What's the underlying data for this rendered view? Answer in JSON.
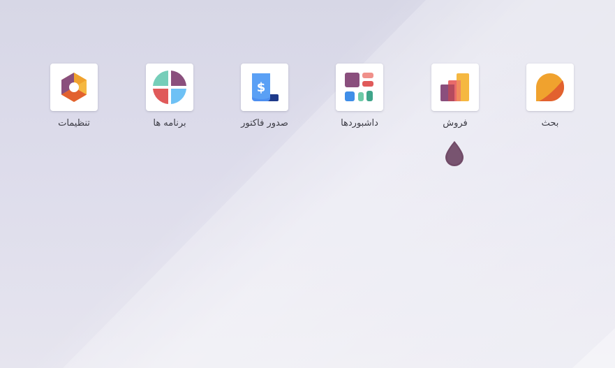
{
  "apps": [
    {
      "key": "discuss",
      "label": "بحث",
      "icon": "discuss-icon"
    },
    {
      "key": "sales",
      "label": "فروش",
      "icon": "sales-icon"
    },
    {
      "key": "dashboards",
      "label": "داشبوردها",
      "icon": "dashboards-icon"
    },
    {
      "key": "invoicing",
      "label": "صدور فاکتور",
      "icon": "invoicing-icon",
      "symbol": "$"
    },
    {
      "key": "apps",
      "label": "برنامه ها",
      "icon": "apps-icon"
    },
    {
      "key": "settings",
      "label": "تنظیمات",
      "icon": "settings-icon"
    }
  ],
  "colors": {
    "background": "#dcdbe8",
    "tile": "#ffffff",
    "label": "#3b3b44",
    "brand_drop": "#714b67"
  }
}
